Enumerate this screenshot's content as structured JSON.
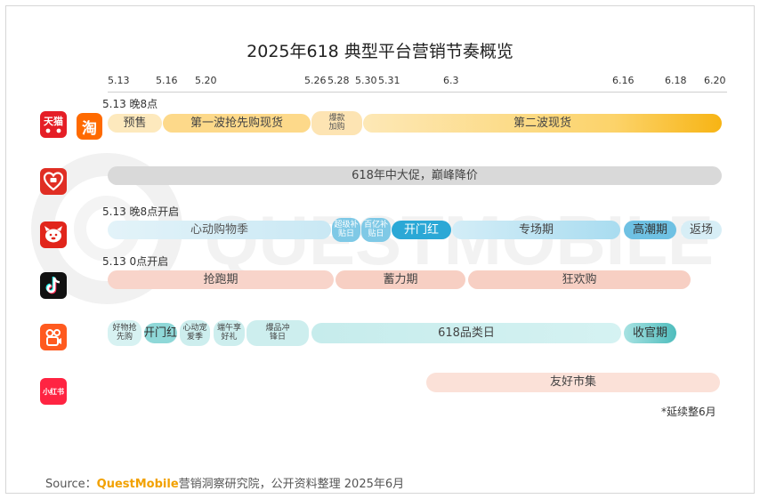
{
  "title": "2025年618 典型平台营销节奏概览",
  "chart_data": {
    "type": "gantt",
    "title": "2025年618 典型平台营销节奏概览",
    "x_axis": {
      "unit": "date",
      "ticks": [
        "5.13",
        "5.16",
        "5.20",
        "5.26",
        "5.28",
        "5.30",
        "5.31",
        "6.3",
        "6.16",
        "6.18",
        "6.20"
      ],
      "range": [
        "5.13",
        "6.20"
      ]
    },
    "rows": [
      {
        "platform": "天猫/淘宝",
        "logos": [
          "天猫",
          "淘"
        ],
        "note": "5.13 晚8点",
        "phases": [
          {
            "label": "预售",
            "start": "5.13",
            "end": "5.16"
          },
          {
            "label": "第一波抢先购现货",
            "start": "5.16",
            "end": "5.26"
          },
          {
            "label": "爆款加购",
            "start": "5.26",
            "end": "5.30"
          },
          {
            "label": "第二波现货",
            "start": "5.30",
            "end": "6.20"
          }
        ]
      },
      {
        "platform": "拼多多",
        "note": "",
        "phases": [
          {
            "label": "618年中大促，巅峰降价",
            "start": "5.13",
            "end": "6.20"
          }
        ]
      },
      {
        "platform": "京东",
        "note": "5.13 晚8点开启",
        "phases": [
          {
            "label": "心动购物季",
            "start": "5.13",
            "end": "5.26"
          },
          {
            "label": "超级补贴日",
            "start": "5.26",
            "end": "5.28"
          },
          {
            "label": "百亿补贴日",
            "start": "5.28",
            "end": "5.30"
          },
          {
            "label": "开门红",
            "start": "5.30",
            "end": "6.3"
          },
          {
            "label": "专场期",
            "start": "6.3",
            "end": "6.16"
          },
          {
            "label": "高潮期",
            "start": "6.16",
            "end": "6.18"
          },
          {
            "label": "返场",
            "start": "6.18",
            "end": "6.20"
          }
        ]
      },
      {
        "platform": "抖音",
        "note": "5.13 0点开启",
        "phases": [
          {
            "label": "抢跑期",
            "start": "5.13",
            "end": "5.26"
          },
          {
            "label": "蓄力期",
            "start": "5.26",
            "end": "6.3"
          },
          {
            "label": "狂欢购",
            "start": "6.3",
            "end": "6.18"
          }
        ]
      },
      {
        "platform": "快手",
        "note": "",
        "phases": [
          {
            "label": "好物抢先购",
            "start": "5.13",
            "end": "5.16"
          },
          {
            "label": "开门红",
            "start": "5.16",
            "end": "5.18"
          },
          {
            "label": "心动宠爱季",
            "start": "5.18",
            "end": "5.21"
          },
          {
            "label": "端午享好礼",
            "start": "5.21",
            "end": "5.24"
          },
          {
            "label": "爆品冲锋日",
            "start": "5.24",
            "end": "5.27"
          },
          {
            "label": "618品类日",
            "start": "5.27",
            "end": "6.16"
          },
          {
            "label": "收官期",
            "start": "6.16",
            "end": "6.18"
          }
        ]
      },
      {
        "platform": "小红书",
        "logos": [
          "小红书"
        ],
        "note": "",
        "phases": [
          {
            "label": "友好市集",
            "start": "6.3",
            "end": "6.20"
          }
        ],
        "footnote": "*延续整6月"
      }
    ]
  },
  "source": {
    "prefix": "Source：",
    "brand": "QuestMobile",
    "text": "营销洞察研究院，公开资料整理 2025年6月"
  },
  "watermark": "QUESTMOBILE",
  "colors": {
    "tmall_light": "#fde7b6",
    "tmall_dark": "#f7b414",
    "pdd": "#d6d6d6",
    "jd_light": "#cfeaf5",
    "jd_mid": "#8fd0ea",
    "jd_dark": "#2aa6d6",
    "douyin": "#f8d2c8",
    "kuaishou": "#cdeeee",
    "kuaishou_dark": "#57c2c2",
    "xhs": "#f9dcd2"
  }
}
